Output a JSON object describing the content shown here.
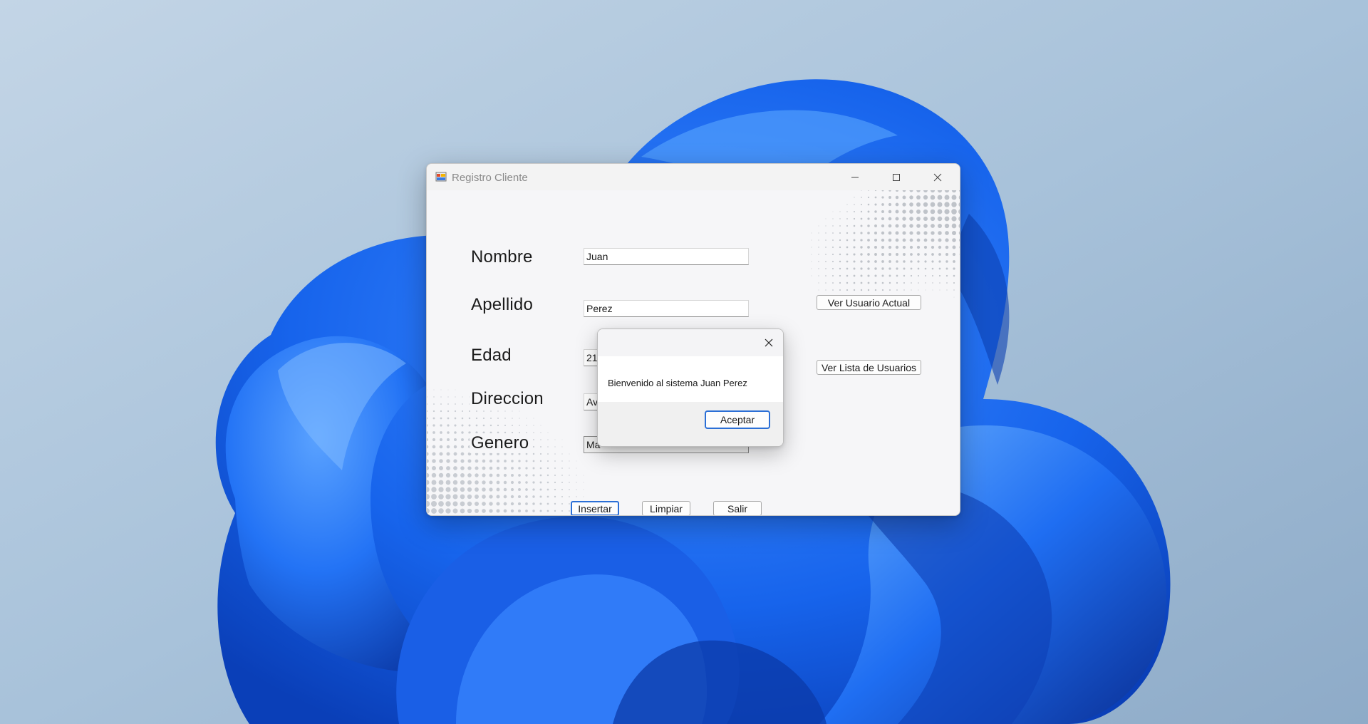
{
  "window": {
    "title": "Registro Cliente"
  },
  "form": {
    "labels": {
      "nombre": "Nombre",
      "apellido": "Apellido",
      "edad": "Edad",
      "direccion": "Direccion",
      "genero": "Genero"
    },
    "values": {
      "nombre": "Juan",
      "apellido": "Perez",
      "edad": "21",
      "direccion": "Av",
      "genero": "Ma"
    },
    "buttons": {
      "ver_usuario_actual": "Ver Usuario Actual",
      "ver_lista_usuarios": "Ver Lista de Usuarios",
      "insertar": "Insertar",
      "limpiar": "Limpiar",
      "salir": "Salir"
    }
  },
  "message_box": {
    "text": "Bienvenido al sistema Juan Perez",
    "ok_label": "Aceptar"
  },
  "colors": {
    "accent": "#2b6fd6",
    "wallpaper_blue": "#1a5fe0"
  }
}
